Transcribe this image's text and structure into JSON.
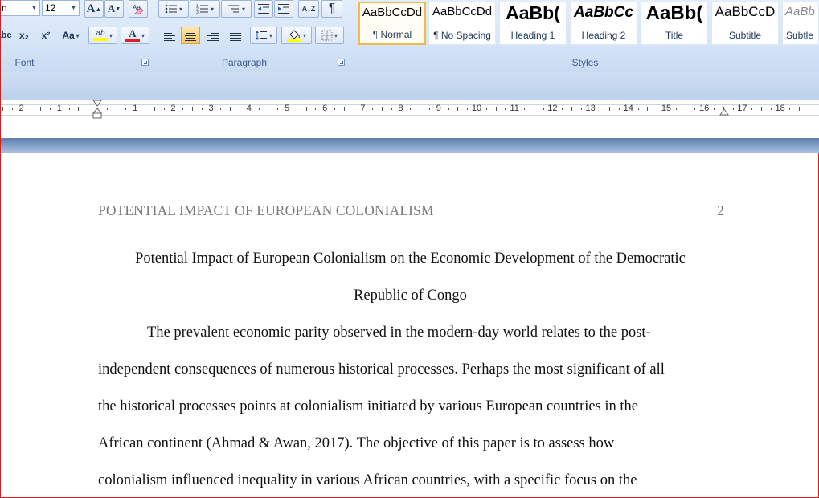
{
  "ribbon": {
    "font": {
      "caption": "Font",
      "font_name_value": "n",
      "font_size_value": "12",
      "grow_label": "A",
      "shrink_label": "A",
      "strike_label": "abc",
      "subscript_label": "x₂",
      "superscript_label": "x²",
      "change_case_label": "Aa",
      "highlight_label": "ab",
      "font_color_label": "A",
      "highlight_color": "#ffff00",
      "font_color": "#e02020"
    },
    "paragraph": {
      "caption": "Paragraph",
      "sort_label": "A↓Z",
      "show_marks_label": "¶"
    },
    "styles": {
      "caption": "Styles",
      "items": [
        {
          "sample": "AaBbCcDd",
          "name": "¶ Normal",
          "selected": true
        },
        {
          "sample": "AaBbCcDd",
          "name": "¶ No Spacing"
        },
        {
          "sample": "AaBb(",
          "name": "Heading 1"
        },
        {
          "sample": "AaBbCc",
          "name": "Heading 2"
        },
        {
          "sample": "AaBb(",
          "name": "Title"
        },
        {
          "sample": "AaBbCcD",
          "name": "Subtitle"
        },
        {
          "sample": "AaBb",
          "name": "Subtle"
        }
      ]
    }
  },
  "ruler": {
    "labels": [
      "2",
      "1",
      "1",
      "2",
      "3",
      "4",
      "5",
      "6",
      "7",
      "8",
      "9",
      "10",
      "11",
      "12",
      "13",
      "14",
      "15",
      "16",
      "17",
      "18"
    ]
  },
  "document": {
    "header_title": "POTENTIAL IMPACT OF EUROPEAN COLONIALISM",
    "page_number": "2",
    "title_line1": "Potential Impact of European Colonialism on the Economic Development of the Democratic",
    "title_line2": "Republic of Congo",
    "body_lines": [
      "The prevalent economic parity observed in the modern-day world relates to the post-",
      "independent consequences of numerous historical processes.  Perhaps the most significant of all",
      "the historical processes points at colonialism initiated by various European countries in the",
      "African continent (Ahmad & Awan, 2017). The objective of this paper is to assess how",
      "colonialism influenced inequality in various African countries, with a specific focus on the"
    ]
  }
}
